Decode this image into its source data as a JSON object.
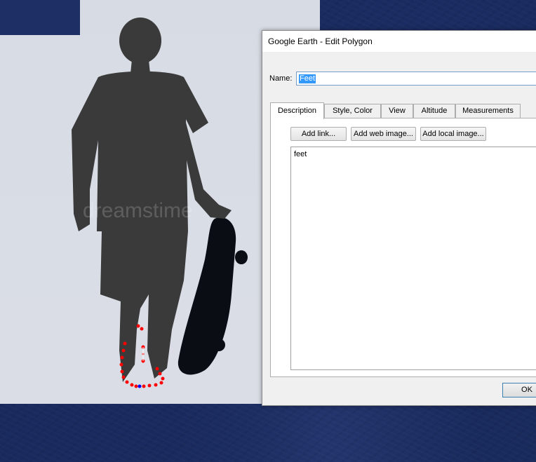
{
  "photo": {
    "watermark": "dreamstime"
  },
  "dialog": {
    "title": "Google Earth - Edit Polygon",
    "name_label": "Name:",
    "name_value": "Feet",
    "tabs": [
      "Description",
      "Style, Color",
      "View",
      "Altitude",
      "Measurements"
    ],
    "active_tab": "Description",
    "buttons": {
      "add_link": "Add link...",
      "add_web_image": "Add web image...",
      "add_local_image": "Add local image..."
    },
    "description_text": "feet",
    "ok_label": "OK"
  },
  "colors": {
    "polygon_vertex": "#ff0000",
    "selected_vertex": "#0000ff",
    "desktop": "#192a5c",
    "selection": "#3399ff"
  }
}
